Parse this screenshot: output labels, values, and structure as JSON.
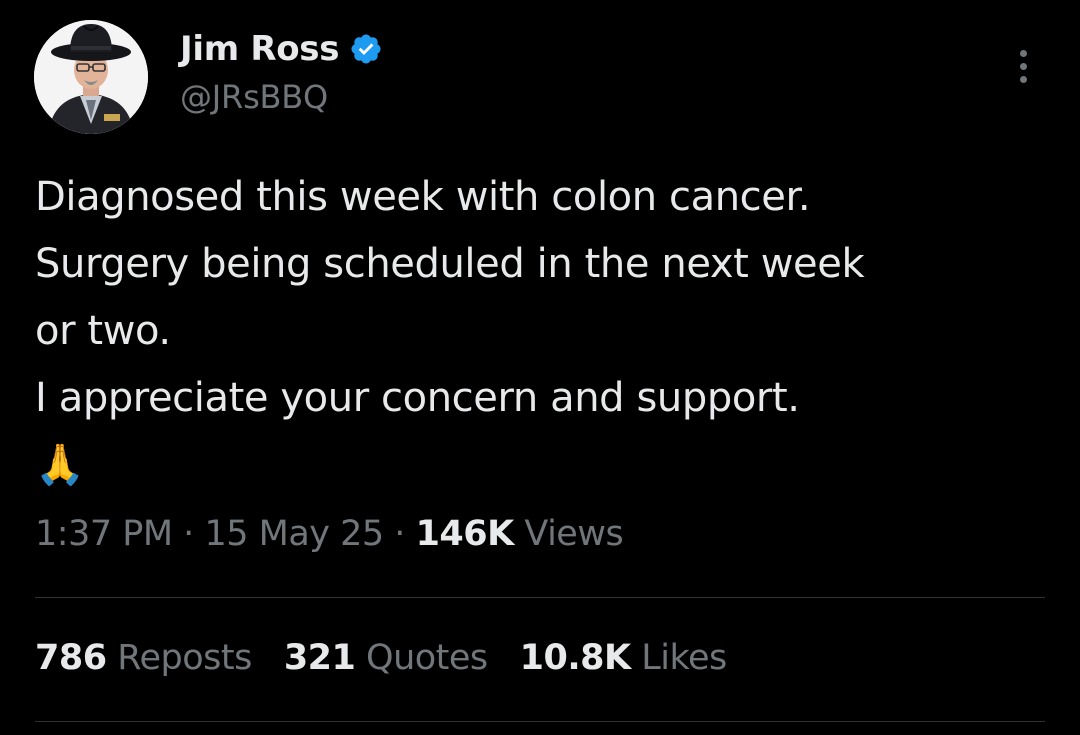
{
  "author": {
    "display_name": "Jim Ross",
    "handle": "@JRsBBQ",
    "verified": true,
    "avatar_icon": "profile-photo-cowboy-hat"
  },
  "tweet": {
    "lines": [
      "Diagnosed this week with colon cancer.",
      "Surgery being scheduled in the next week",
      "or two.",
      "I appreciate your concern and support."
    ],
    "emoji": "🙏"
  },
  "meta": {
    "time": "1:37 PM",
    "separator": "·",
    "date": "15 May 25",
    "views_count": "146K",
    "views_label": "Views"
  },
  "stats": {
    "reposts_count": "786",
    "reposts_label": "Reposts",
    "quotes_count": "321",
    "quotes_label": "Quotes",
    "likes_count": "10.8K",
    "likes_label": "Likes"
  },
  "colors": {
    "background": "#000000",
    "primary_text": "#e7e9ea",
    "secondary_text": "#71767b",
    "divider": "#2f3336",
    "verified_badge": "#1d9bf0"
  }
}
